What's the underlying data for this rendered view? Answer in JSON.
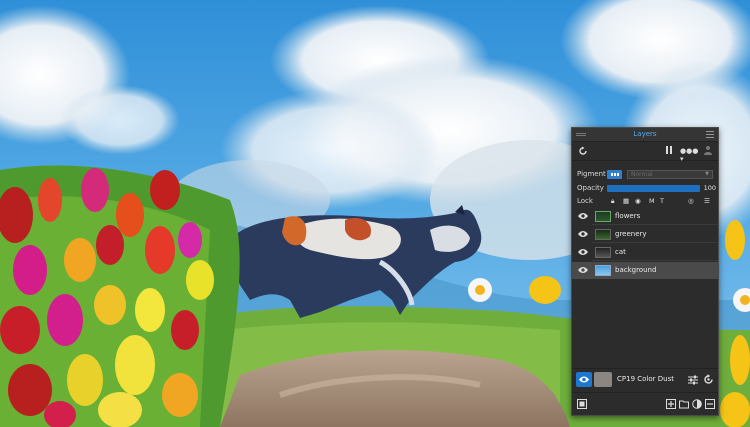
{
  "panel": {
    "title": "Layers",
    "toolbar": {
      "refresh_icon": "refresh-icon",
      "pause_icon": "pause-icon",
      "dots_icon": "dots-dropdown-icon",
      "person_icon": "person-icon"
    },
    "pigment": {
      "label": "Pigment",
      "blend_mode": "Normal"
    },
    "opacity": {
      "label": "Opacity",
      "value": "100"
    },
    "lock": {
      "label": "Lock",
      "icons": [
        "lock-icon",
        "checker-icon",
        "dot-icon",
        "M",
        "T"
      ]
    },
    "layers": [
      {
        "name": "flowers",
        "visible": true,
        "selected": false
      },
      {
        "name": "greenery",
        "visible": true,
        "selected": false
      },
      {
        "name": "cat",
        "visible": true,
        "selected": false
      },
      {
        "name": "background",
        "visible": true,
        "selected": true
      }
    ],
    "brush": {
      "name": "CP19 Color Dust"
    },
    "colors": {
      "accent": "#1e78d0",
      "title": "#55a8f0",
      "panel_bg": "#2c2c2c"
    }
  }
}
